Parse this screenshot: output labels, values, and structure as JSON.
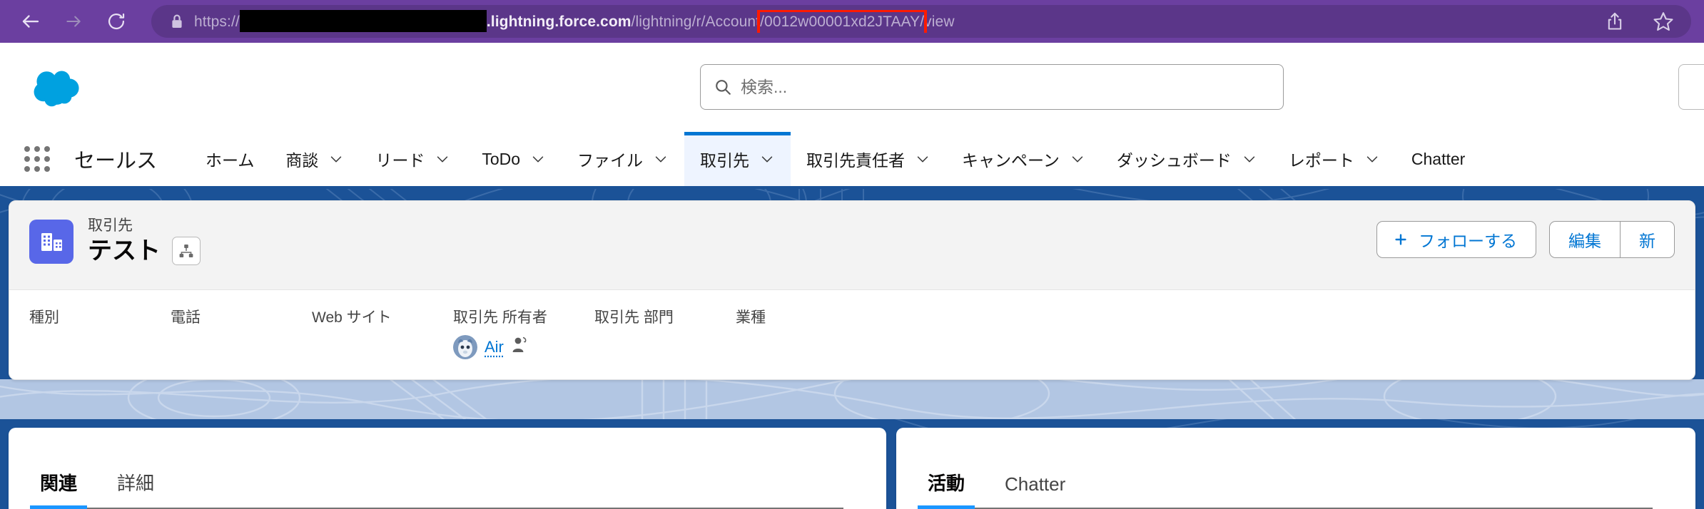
{
  "browser": {
    "back_icon": "arrow-left-icon",
    "forward_icon": "arrow-right-icon",
    "reload_icon": "reload-icon",
    "lock_icon": "lock-icon",
    "share_icon": "share-icon",
    "bookmark_icon": "star-icon",
    "url": {
      "scheme": "https://",
      "redacted": "",
      "host_suffix": ".lightning.force.com",
      "path_before": "/lightning/r/Account",
      "highlighted": "/0012w00001xd2JTAAY/",
      "path_after": "view",
      "highlight_color": "#FF1A00"
    },
    "chrome_color": "#6B3FA0"
  },
  "sf_header": {
    "logo_icon": "salesforce-cloud-logo",
    "logo_color": "#00A1E0",
    "search": {
      "icon": "search-icon",
      "placeholder": "検索...",
      "value": ""
    }
  },
  "app_nav": {
    "launcher_icon": "app-launcher-icon",
    "app_name": "セールス",
    "items": [
      {
        "label": "ホーム",
        "has_menu": false,
        "active": false
      },
      {
        "label": "商談",
        "has_menu": true,
        "active": false
      },
      {
        "label": "リード",
        "has_menu": true,
        "active": false
      },
      {
        "label": "ToDo",
        "has_menu": true,
        "active": false
      },
      {
        "label": "ファイル",
        "has_menu": true,
        "active": false
      },
      {
        "label": "取引先",
        "has_menu": true,
        "active": true
      },
      {
        "label": "取引先責任者",
        "has_menu": true,
        "active": false
      },
      {
        "label": "キャンペーン",
        "has_menu": true,
        "active": false
      },
      {
        "label": "ダッシュボード",
        "has_menu": true,
        "active": false
      },
      {
        "label": "レポート",
        "has_menu": true,
        "active": false
      },
      {
        "label": "Chatter",
        "has_menu": false,
        "active": false
      }
    ],
    "active_color": "#0176D3"
  },
  "record": {
    "object_icon": "account-building-icon",
    "object_icon_color": "#5867E8",
    "object_label": "取引先",
    "name": "テスト",
    "hierarchy_icon": "hierarchy-icon",
    "actions": {
      "follow_icon": "plus-icon",
      "follow_label": "フォローする",
      "edit_label": "編集",
      "new_label": "新"
    },
    "fields": [
      {
        "label": "種別",
        "value": ""
      },
      {
        "label": "電話",
        "value": ""
      },
      {
        "label": "Web サイト",
        "value": ""
      },
      {
        "label": "取引先 所有者",
        "value": "Air",
        "is_link": true,
        "avatar_icon": "user-avatar-icon",
        "change_owner_icon": "change-owner-icon"
      },
      {
        "label": "取引先 部門",
        "value": ""
      },
      {
        "label": "業種",
        "value": ""
      }
    ]
  },
  "panels": {
    "left_tabs": [
      {
        "label": "関連",
        "active": true
      },
      {
        "label": "詳細",
        "active": false
      }
    ],
    "right_tabs": [
      {
        "label": "活動",
        "active": true
      },
      {
        "label": "Chatter",
        "active": false
      }
    ],
    "active_underline_color": "#1B96FF"
  },
  "theme": {
    "page_bg": "#1B5297",
    "band_bg": "#B2C6E3",
    "card_bg": "#F3F3F3",
    "link_color": "#0176D3"
  }
}
